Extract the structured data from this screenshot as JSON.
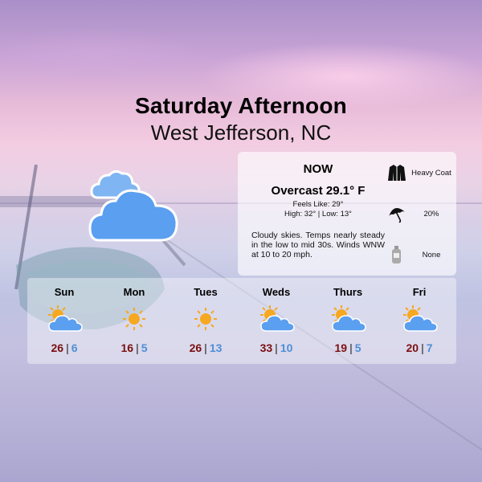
{
  "header": {
    "title": "Saturday Afternoon",
    "location": "West Jefferson, NC"
  },
  "current": {
    "icon": "overcast-cloud-icon",
    "now_label": "NOW",
    "condition": "Overcast 29.1° F",
    "feels_like": "Feels Like: 29°",
    "high_low": "High: 32° | Low: 13°",
    "description": "Cloudy skies. Temps nearly steady in the low to mid 30s. Winds WNW at 10 to 20 mph."
  },
  "advice": [
    {
      "icon": "jacket-icon",
      "label": "Heavy Coat"
    },
    {
      "icon": "umbrella-icon",
      "label": "20%"
    },
    {
      "icon": "sunscreen-icon",
      "label": "None"
    }
  ],
  "forecast": [
    {
      "day": "Sun",
      "icon": "partly-cloudy-icon",
      "high": "26",
      "low": "6"
    },
    {
      "day": "Mon",
      "icon": "sun-icon",
      "high": "16",
      "low": "5"
    },
    {
      "day": "Tues",
      "icon": "sun-icon",
      "high": "26",
      "low": "13"
    },
    {
      "day": "Weds",
      "icon": "partly-cloudy-icon",
      "high": "33",
      "low": "10"
    },
    {
      "day": "Thurs",
      "icon": "partly-cloudy-icon",
      "high": "19",
      "low": "5"
    },
    {
      "day": "Fri",
      "icon": "partly-cloudy-icon",
      "high": "20",
      "low": "7"
    }
  ],
  "colors": {
    "high_temp": "#7a1010",
    "low_temp": "#4d8fd6",
    "cloud_fill": "#5a9ff0",
    "sun_fill": "#f6a821"
  }
}
